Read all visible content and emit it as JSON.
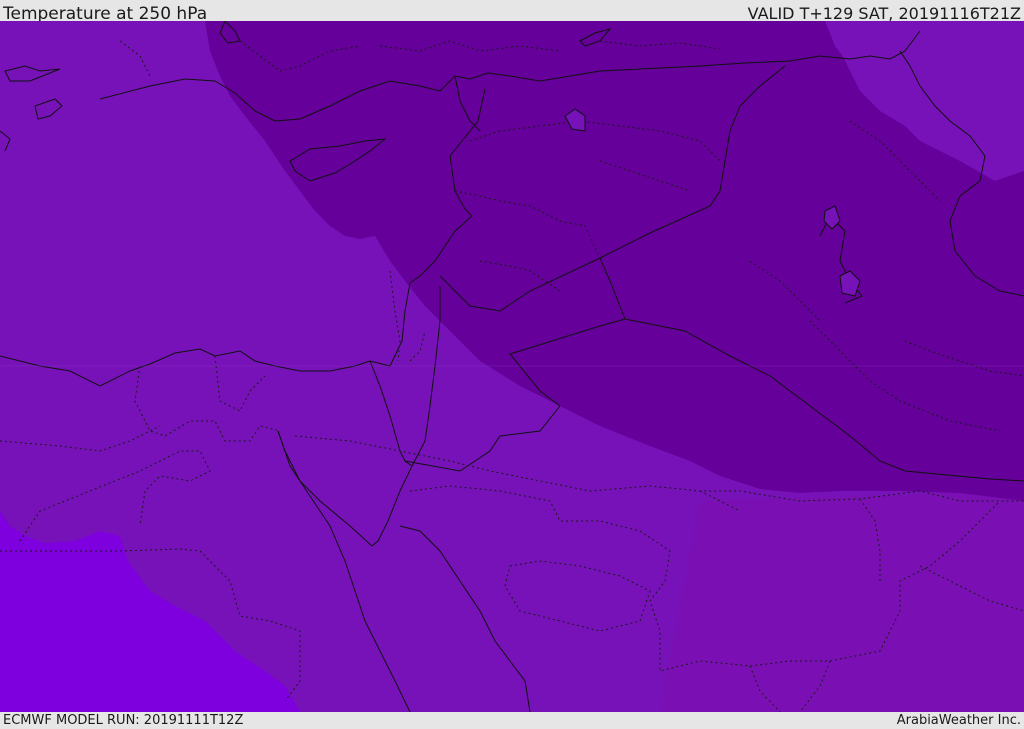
{
  "header": {
    "title": "Temperature at 250 hPa",
    "valid": "VALID T+129 SAT, 20191116T21Z"
  },
  "footer": {
    "model_run": "ECMWF MODEL RUN: 20191111T12Z",
    "credit": "ArabiaWeather Inc."
  },
  "colors": {
    "band_warm": "#7f00df",
    "band_mid": "#7712b8",
    "band_mid_alt": "#7a10b3",
    "band_cold": "#65009a",
    "band_cold_alt": "#6a0aa0",
    "border": "#111111",
    "bar_background": "#e6e6e6"
  }
}
